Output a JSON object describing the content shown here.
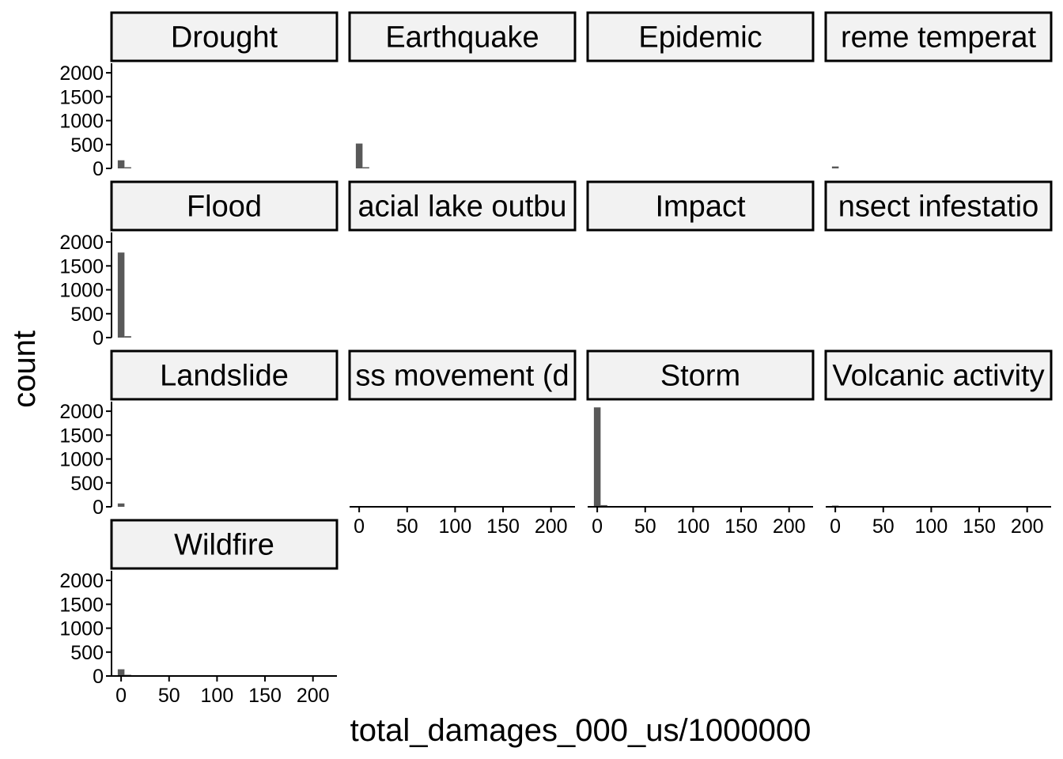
{
  "chart_data": {
    "type": "bar",
    "title": "",
    "xlabel": "total_damages_000_us/1000000",
    "ylabel": "count",
    "xlim": [
      -10,
      225
    ],
    "ylim": [
      0,
      2200
    ],
    "x_ticks": [
      "0",
      "50",
      "100",
      "150",
      "200"
    ],
    "y_ticks": [
      "0",
      "500",
      "1000",
      "1500",
      "2000"
    ],
    "bin_width": 7,
    "grid": false,
    "colors": {
      "bar": "#595959",
      "strip": "#f2f2f2",
      "axis": "#000000"
    },
    "panels": [
      {
        "label": "Drought",
        "bins": [
          {
            "x": 0,
            "count": 170
          },
          {
            "x": 7,
            "count": 8
          }
        ]
      },
      {
        "label": "Earthquake",
        "bins": [
          {
            "x": 0,
            "count": 520
          },
          {
            "x": 7,
            "count": 15
          }
        ]
      },
      {
        "label": "Epidemic",
        "bins": []
      },
      {
        "label": "reme temperat",
        "bins": [
          {
            "x": 0,
            "count": 40
          }
        ]
      },
      {
        "label": "Flood",
        "bins": [
          {
            "x": 0,
            "count": 1780
          },
          {
            "x": 7,
            "count": 30
          }
        ]
      },
      {
        "label": "acial lake outbu",
        "bins": []
      },
      {
        "label": "Impact",
        "bins": []
      },
      {
        "label": "nsect infestatio",
        "bins": []
      },
      {
        "label": "Landslide",
        "bins": [
          {
            "x": 0,
            "count": 70
          }
        ]
      },
      {
        "label": "ss movement (d",
        "bins": []
      },
      {
        "label": "Storm",
        "bins": [
          {
            "x": 0,
            "count": 2080
          },
          {
            "x": 7,
            "count": 35
          }
        ]
      },
      {
        "label": "Volcanic activity",
        "bins": [
          {
            "x": 0,
            "count": 25
          }
        ]
      },
      {
        "label": "Wildfire",
        "bins": [
          {
            "x": 0,
            "count": 140
          },
          {
            "x": 7,
            "count": 5
          }
        ]
      }
    ]
  }
}
